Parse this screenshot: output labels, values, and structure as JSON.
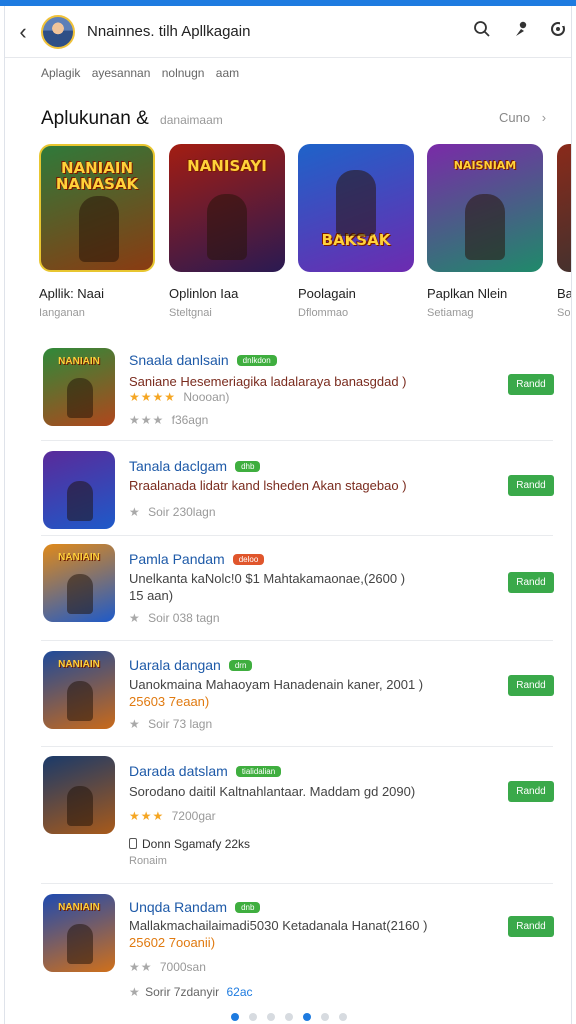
{
  "header": {
    "title": "Nnainnes. tilh Apllkagain",
    "back_icon": "chevron-left-icon",
    "icons": [
      "search-icon",
      "user-icon",
      "settings-icon"
    ]
  },
  "breadcrumb": "Aplagik ayesannan nolnugn aam",
  "section": {
    "title": "Aplukunan",
    "amp": "&",
    "subtitle": "danaimaam",
    "see_more": "Cuno"
  },
  "featured": [
    {
      "art_text": "NANIAIN NANASAK",
      "name": "Apllik: Naai",
      "sub": "Ianganan",
      "colors": [
        "#2f7a3a",
        "#8a3b12"
      ]
    },
    {
      "art_text": "NANISAYI",
      "name": "Oplinlon Iaa",
      "sub": "Steltgnai",
      "colors": [
        "#a31d12",
        "#2a1a52"
      ]
    },
    {
      "art_text": "BAKSAK",
      "name": "Poolagain",
      "sub": "Dflommao",
      "colors": [
        "#1e63c9",
        "#6d2bb0"
      ]
    },
    {
      "art_text": "NAISNIAM",
      "name": "Paplkan Nlein",
      "sub": "Setiamag",
      "colors": [
        "#7a2aa8",
        "#1f8a6a"
      ]
    },
    {
      "art_text": "",
      "name": "Bap",
      "sub": "Soin",
      "colors": [
        "#8a2a1a",
        "#333333"
      ]
    }
  ],
  "apps": [
    {
      "title": "Snaala danlsain",
      "badge": "dnlkdon",
      "badge_color": "green",
      "desc": "Saniane Hesemeriagika ladalaraya banasgdad )",
      "stars_filled": "★★★★",
      "stars_empty": "",
      "meta": "Noooan)",
      "line3_stars": "★★★",
      "line3": "f36agn",
      "get": "Randd",
      "colors": [
        "#2f8a3a",
        "#b0461c"
      ]
    },
    {
      "title": "Tanala daclgam",
      "badge": "dhb",
      "badge_color": "green",
      "desc": "Rraalanada lidatr kand lsheden Akan stagebao )",
      "line3_stars": "★",
      "line3": "Soir 230lagn",
      "get": "Randd",
      "colors": [
        "#5a2a9a",
        "#1e5ac9"
      ]
    },
    {
      "title": "Pamla Pandam",
      "badge": "deloo",
      "badge_color": "red",
      "desc": "Unelkanta kaNolc!0 $1 Mahtakamaonae,(2600 )",
      "desc_line2": "15 aan)",
      "line3_stars": "★",
      "line3": "Soir 038 tagn",
      "get": "Randd",
      "colors": [
        "#e08a1a",
        "#1e5ac9"
      ]
    },
    {
      "title": "Uarala dangan",
      "badge": "drn",
      "badge_color": "green",
      "desc": "Uanokmaina Mahaoyam Hanadenain kaner, 2001 )",
      "desc_line2": "25603 7eaan)",
      "line3_stars": "★",
      "line3": "Soir 73 lagn",
      "get": "Randd",
      "colors": [
        "#1e4a9a",
        "#c96a1a"
      ]
    },
    {
      "title": "Darada datslam",
      "badge": "tialidalian",
      "badge_color": "green",
      "desc": "Sorodano daitil Kaltnahlantaar. Maddam gd 2090)",
      "stars_filled": "★★★",
      "meta": "7200gar",
      "extra": "Donn Sgamafy 22ks",
      "extra2": "Ronaim",
      "get": "Randd",
      "colors": [
        "#1a3a6a",
        "#a85a1a"
      ]
    },
    {
      "title": "Unqda Randam",
      "badge": "dnb",
      "badge_color": "green",
      "desc": "Mallakmachailaimadi5030 Ketadanala Hanat(2160 )",
      "desc_line2": "25602 7ooanii)",
      "line3_stars": "★★",
      "line3": "7000san",
      "extra": "Sorir 7zdanyir",
      "extra_blue": "62ac",
      "get": "Randd",
      "colors": [
        "#1e4ab0",
        "#d0701a"
      ]
    }
  ],
  "pager": {
    "count": 7,
    "active": [
      0,
      4
    ]
  }
}
